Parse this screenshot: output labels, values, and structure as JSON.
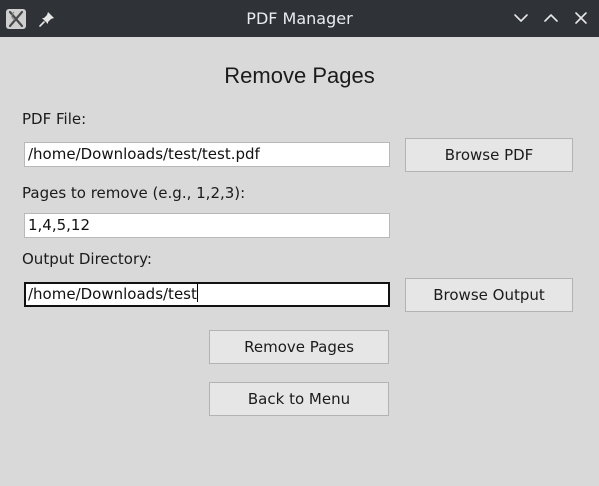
{
  "window": {
    "title": "PDF Manager",
    "icons": {
      "app": "app-logo-icon",
      "pin": "pin-icon",
      "minimize": "chevron-down-icon",
      "maximize": "chevron-up-icon",
      "close": "close-icon"
    }
  },
  "form": {
    "heading": "Remove Pages",
    "pdf_label": "PDF File:",
    "pdf_value": "/home/Downloads/test/test.pdf",
    "browse_pdf": "Browse PDF",
    "pages_label": "Pages to remove (e.g., 1,2,3):",
    "pages_value": "1,4,5,12",
    "output_label": "Output Directory:",
    "output_value": "/home/Downloads/test",
    "browse_output": "Browse Output",
    "remove_button": "Remove Pages",
    "back_button": "Back to Menu"
  }
}
